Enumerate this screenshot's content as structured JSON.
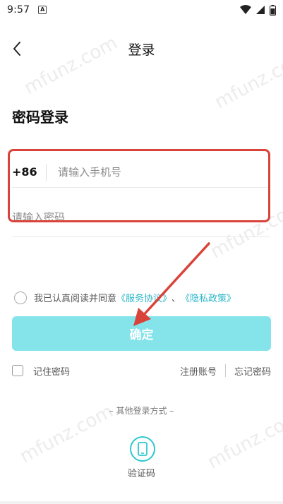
{
  "status_bar": {
    "time": "9:57",
    "notification_icon": "a-icon",
    "icons": [
      "wifi-icon",
      "signal-icon",
      "battery-icon"
    ]
  },
  "header": {
    "title": "登录",
    "back_icon": "chevron-left-icon"
  },
  "form": {
    "section_title": "密码登录",
    "country_code": "+86",
    "phone_placeholder": "请输入手机号",
    "password_placeholder": "请输入密码"
  },
  "agreement": {
    "prefix": "我已认真阅读并同意",
    "service_link": "《服务协议》",
    "joiner": "、",
    "privacy_link": "《隐私政策》"
  },
  "confirm_button": "确定",
  "options": {
    "remember_label": "记住密码",
    "register_label": "注册账号",
    "forgot_label": "忘记密码"
  },
  "other_login": {
    "title": "– 其他登录方式 –",
    "sms_label": "验证码",
    "sms_icon": "phone-icon"
  },
  "watermark": "mfunz.com",
  "colors": {
    "accent": "#2ec7cf",
    "button_bg": "#84e4ea",
    "highlight": "#d9433a",
    "link": "#2ab6c8"
  }
}
